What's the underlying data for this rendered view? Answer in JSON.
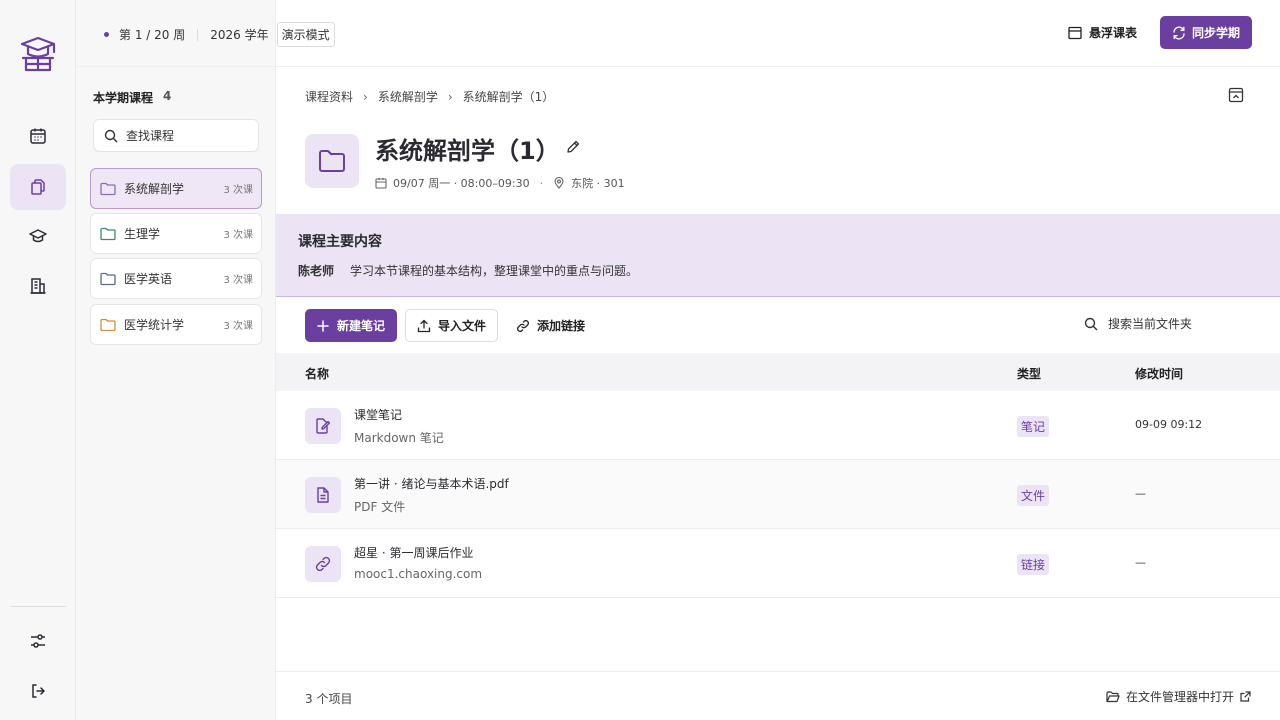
{
  "topbar": {
    "week": "第 1 / 20 周",
    "year": "2026 学年",
    "mode": "演示模式",
    "float_label": "悬浮课表",
    "sync_label": "同步学期"
  },
  "sidebar": {
    "title": "本学期课程",
    "count": "4",
    "search_placeholder": "查找课程",
    "courses": [
      {
        "name": "系统解剖学",
        "times": "3 次课"
      },
      {
        "name": "生理学",
        "times": "3 次课"
      },
      {
        "name": "医学英语",
        "times": "3 次课"
      },
      {
        "name": "医学统计学",
        "times": "3 次课"
      }
    ]
  },
  "breadcrumb": [
    "课程资料",
    "系统解剖学",
    "系统解剖学（1）"
  ],
  "header": {
    "title": "系统解剖学（1）",
    "datetime": "09/07 周一 · 08:00–09:30",
    "location": "东院 · 301"
  },
  "banner": {
    "title": "课程主要内容",
    "teacher": "陈老师",
    "text": "学习本节课程的基本结构，整理课堂中的重点与问题。"
  },
  "actions": {
    "new_note": "新建笔记",
    "import_file": "导入文件",
    "add_link": "添加链接",
    "search_placeholder": "搜索当前文件夹"
  },
  "table": {
    "headers": {
      "name": "名称",
      "type": "类型",
      "modified": "修改时间"
    },
    "rows": [
      {
        "name": "课堂笔记",
        "sub": "Markdown 笔记",
        "type": "笔记",
        "modified": "09-09 09:12",
        "icon": "note-edit-icon"
      },
      {
        "name": "第一讲 · 绪论与基本术语.pdf",
        "sub": "PDF 文件",
        "type": "文件",
        "modified": "—",
        "icon": "document-icon"
      },
      {
        "name": "超星 · 第一周课后作业",
        "sub": "mooc1.chaoxing.com",
        "type": "链接",
        "modified": "—",
        "icon": "link-icon"
      }
    ]
  },
  "footer": {
    "count": "3 个项目",
    "open_label": "在文件管理器中打开"
  },
  "colors": {
    "accent": "#6b3fa0",
    "accent_light": "#ece3f4"
  }
}
